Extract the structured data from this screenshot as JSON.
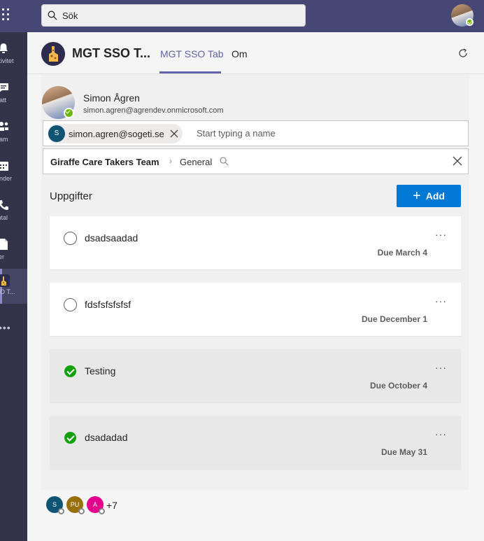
{
  "search": {
    "placeholder": "Sök"
  },
  "rail": {
    "items": [
      {
        "label": "ktivitet",
        "icon": "bell-icon"
      },
      {
        "label": "hatt",
        "icon": "chat-icon"
      },
      {
        "label": "eam",
        "icon": "teams-icon"
      },
      {
        "label": "ender",
        "icon": "calendar-icon"
      },
      {
        "label": "mtal",
        "icon": "phone-icon"
      },
      {
        "label": "iler",
        "icon": "file-icon"
      },
      {
        "label": "SO T...",
        "icon": "giraffe-app-icon"
      }
    ],
    "more": "•••"
  },
  "header": {
    "title": "MGT SSO T...",
    "tabs": [
      {
        "label": "MGT SSO Tab",
        "active": true
      },
      {
        "label": "Om",
        "active": false
      }
    ]
  },
  "person": {
    "name": "Simon Ågren",
    "email": "simon.agren@agrendev.onmicrosoft.com",
    "status": "available"
  },
  "picker": {
    "chip_initial": "S",
    "chip_label": "simon.agren@sogeti.se",
    "placeholder": "Start typing a name"
  },
  "channel": {
    "team": "Giraffe Care Takers Team",
    "separator": "›",
    "channel": "General"
  },
  "tasks_section": {
    "title": "Uppgifter",
    "add_label": "Add"
  },
  "tasks": [
    {
      "title": "dsadsaadad",
      "due": "Due March 4",
      "completed": false
    },
    {
      "title": "fdsfsfsfsfsf",
      "due": "Due December 1",
      "completed": false
    },
    {
      "title": "Testing",
      "due": "Due October 4",
      "completed": true
    },
    {
      "title": "dsadadad",
      "due": "Due May 31",
      "completed": true
    }
  ],
  "facepile": {
    "people": [
      {
        "initials": "S",
        "color": "#0f5473"
      },
      {
        "initials": "PU",
        "color": "#986f0b"
      },
      {
        "initials": "A",
        "color": "#e3008c"
      }
    ],
    "more": "+7"
  },
  "colors": {
    "brand": "#6264a7",
    "topbar": "#464775",
    "accent": "#0078d4",
    "done": "#13a10e"
  }
}
